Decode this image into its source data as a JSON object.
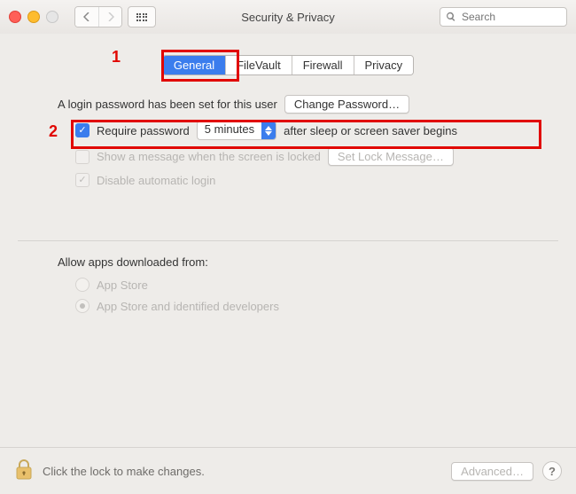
{
  "window": {
    "title": "Security & Privacy",
    "search_placeholder": "Search"
  },
  "tabs": [
    {
      "label": "General",
      "active": true
    },
    {
      "label": "FileVault",
      "active": false
    },
    {
      "label": "Firewall",
      "active": false
    },
    {
      "label": "Privacy",
      "active": false
    }
  ],
  "general": {
    "login_text": "A login password has been set for this user",
    "change_password_btn": "Change Password…",
    "require_password_label": "Require password",
    "require_password_delay": "5 minutes",
    "require_password_suffix": "after sleep or screen saver begins",
    "show_message_label": "Show a message when the screen is locked",
    "set_lock_message_btn": "Set Lock Message…",
    "disable_auto_login_label": "Disable automatic login"
  },
  "allow_apps": {
    "title": "Allow apps downloaded from:",
    "options": [
      {
        "label": "App Store",
        "selected": false
      },
      {
        "label": "App Store and identified developers",
        "selected": true
      }
    ]
  },
  "footer": {
    "lock_text": "Click the lock to make changes.",
    "advanced_btn": "Advanced…"
  },
  "annotations": {
    "one": "1",
    "two": "2"
  }
}
